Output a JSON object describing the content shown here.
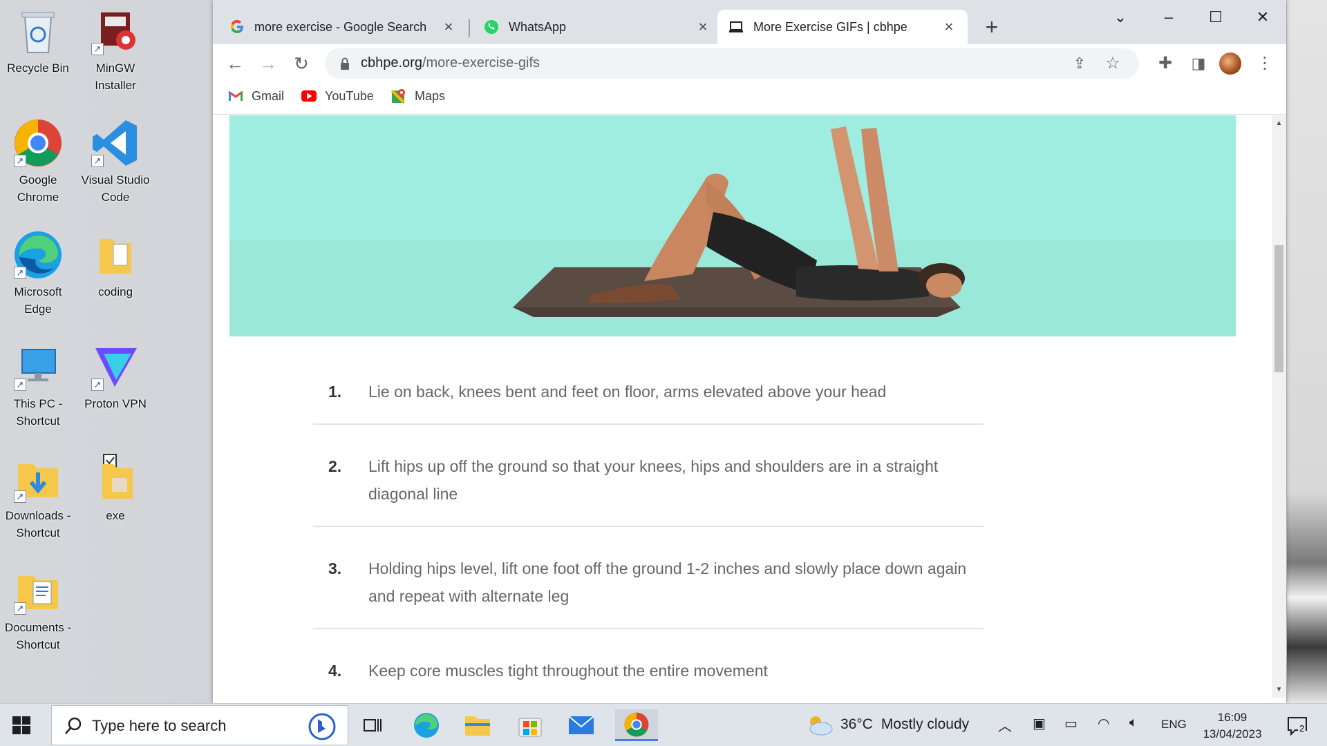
{
  "desktop": {
    "icons": [
      {
        "label": "Recycle Bin"
      },
      {
        "label": "MinGW Installer"
      },
      {
        "label": "Google Chrome"
      },
      {
        "label": "Visual Studio Code"
      },
      {
        "label": "Microsoft Edge"
      },
      {
        "label": "coding"
      },
      {
        "label": "This PC - Shortcut"
      },
      {
        "label": "Proton VPN"
      },
      {
        "label": "Downloads - Shortcut"
      },
      {
        "label": "exe"
      },
      {
        "label": "Documents - Shortcut"
      }
    ]
  },
  "browser": {
    "tabs": [
      {
        "title": "more exercise - Google Search",
        "icon": "google-icon"
      },
      {
        "title": "WhatsApp",
        "icon": "whatsapp-icon"
      },
      {
        "title": "More Exercise GIFs | cbhpe",
        "icon": "laptop-icon",
        "active": true
      }
    ],
    "new_tab": "+",
    "url_domain": "cbhpe.org",
    "url_path": "/more-exercise-gifs",
    "bookmarks": [
      {
        "label": "Gmail",
        "icon": "gmail-icon"
      },
      {
        "label": "YouTube",
        "icon": "youtube-icon"
      },
      {
        "label": "Maps",
        "icon": "maps-icon"
      }
    ],
    "accent": "#1a73e8"
  },
  "page": {
    "hero_bg": "#9fede0",
    "steps": [
      {
        "num": "1.",
        "text": "Lie on back, knees bent and feet on floor, arms elevated above your head"
      },
      {
        "num": "2.",
        "text": "Lift hips up off the ground so that your knees, hips and shoulders are in a straight diagonal line"
      },
      {
        "num": "3.",
        "text": "Holding hips level, lift one foot off the ground 1-2 inches and slowly place down again and repeat with alternate leg"
      },
      {
        "num": "4.",
        "text": "Keep core muscles tight throughout the entire movement"
      }
    ]
  },
  "taskbar": {
    "search_placeholder": "Type here to search",
    "weather_temp": "36°C",
    "weather_desc": "Mostly cloudy",
    "language": "ENG",
    "time": "16:09",
    "date": "13/04/2023",
    "notification_count": "2"
  }
}
